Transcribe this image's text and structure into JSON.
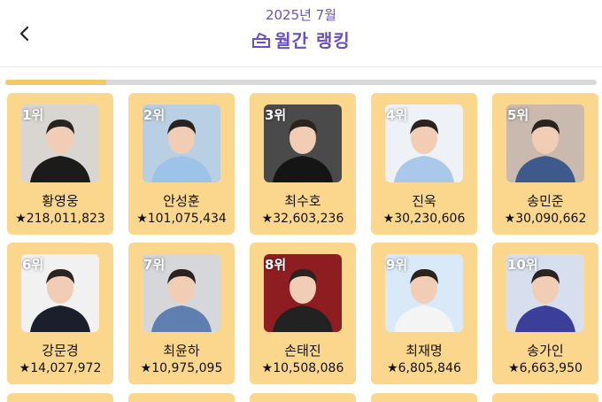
{
  "header": {
    "date": "2025년 7월",
    "title": "월간 랭킹",
    "title_icon": "vote-box-icon",
    "back_icon": "chevron-left-icon"
  },
  "progress": {
    "fraction": 0.17
  },
  "colors": {
    "accent": "#6b4fc8",
    "card": "#fbd78e",
    "progress": "#f6c766"
  },
  "rankings": [
    {
      "rank": "1위",
      "name": "황영웅",
      "score": "★218,011,823",
      "bg": "#d9d6d2",
      "shirt": "#1b1b1b"
    },
    {
      "rank": "2위",
      "name": "안성훈",
      "score": "★101,075,434",
      "bg": "#b9cfe3",
      "shirt": "#9ec3e8"
    },
    {
      "rank": "3위",
      "name": "최수호",
      "score": "★32,603,236",
      "bg": "#4a4a4a",
      "shirt": "#151515"
    },
    {
      "rank": "4위",
      "name": "진욱",
      "score": "★30,230,606",
      "bg": "#eef2f6",
      "shirt": "#a9c8ea"
    },
    {
      "rank": "5위",
      "name": "송민준",
      "score": "★30,090,662",
      "bg": "#c9b9ae",
      "shirt": "#3d5a8a"
    },
    {
      "rank": "6위",
      "name": "강문경",
      "score": "★14,027,972",
      "bg": "#f1f1f1",
      "shirt": "#1b1f2b"
    },
    {
      "rank": "7위",
      "name": "최윤하",
      "score": "★10,975,095",
      "bg": "#d5d7da",
      "shirt": "#5f7fb0"
    },
    {
      "rank": "8위",
      "name": "손태진",
      "score": "★10,508,086",
      "bg": "#8e1d22",
      "shirt": "#222"
    },
    {
      "rank": "9위",
      "name": "최재명",
      "score": "★6,805,846",
      "bg": "#d9e9f7",
      "shirt": "#f4f4f4"
    },
    {
      "rank": "10위",
      "name": "송가인",
      "score": "★6,663,950",
      "bg": "#d7dfef",
      "shirt": "#3b3f9a"
    }
  ]
}
